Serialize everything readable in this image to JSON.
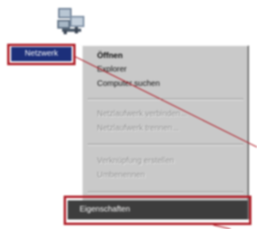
{
  "desktop_icon": {
    "label": "Netzwerk",
    "icon": "network-neighborhood-icon"
  },
  "context_menu": {
    "items": [
      {
        "label": "Öffnen",
        "state": "default"
      },
      {
        "label": "Explorer",
        "state": "normal"
      },
      {
        "label": "Computer suchen",
        "state": "normal"
      },
      {
        "label": "Netzlaufwerk verbinden...",
        "state": "disabled"
      },
      {
        "label": "Netzlaufwerk trennen...",
        "state": "disabled"
      },
      {
        "label": "Verknüpfung erstellen",
        "state": "disabled"
      },
      {
        "label": "Umbenennen",
        "state": "disabled"
      },
      {
        "label": "Eigenschaften",
        "state": "selected"
      }
    ]
  },
  "colors": {
    "highlight_box": "#b0202a",
    "menu_background": "#c9c9c9",
    "selection": "#3d3d3d",
    "icon_label_background": "#1c2f7a"
  }
}
